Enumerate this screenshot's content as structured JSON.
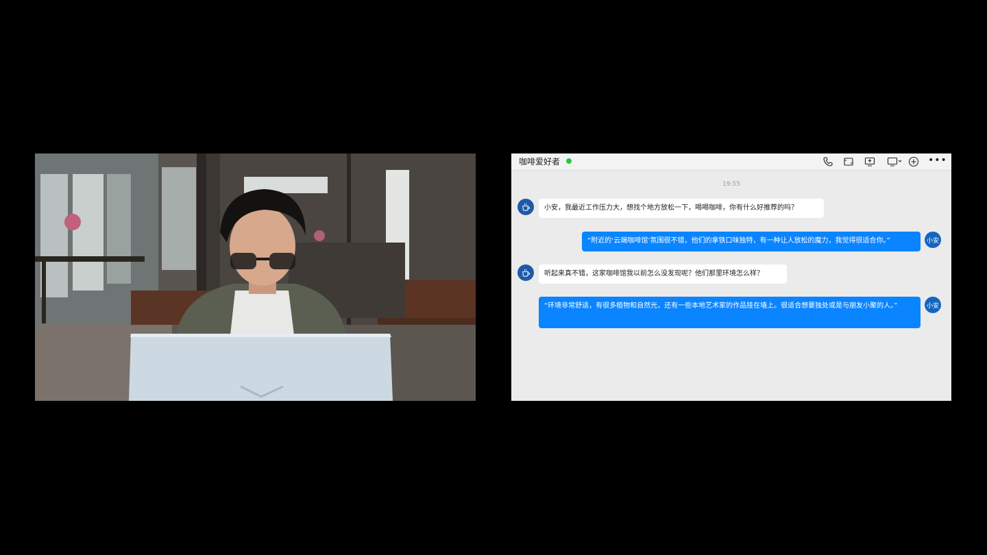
{
  "chat": {
    "title": "咖啡爱好者",
    "status_color": "#28c840",
    "timestamp": "19:55",
    "messages": [
      {
        "sender": "contact",
        "avatar_icon": "coffee-cup-icon",
        "text": "小安，我最近工作压力大，想找个地方放松一下，喝喝咖啡，你有什么好推荐的吗？"
      },
      {
        "sender": "me",
        "avatar_label": "小安",
        "text": "“附近的‘云端咖啡馆’氛围很不错，他们的拿铁口味独特，有一种让人放松的魔力，我觉得很适合你。”"
      },
      {
        "sender": "contact",
        "avatar_icon": "coffee-cup-icon",
        "text": "听起来真不错，这家咖啡馆我以前怎么没发现呢？他们那里环境怎么样？"
      },
      {
        "sender": "me",
        "avatar_label": "小安",
        "text": "“环境非常舒适，有很多植物和自然光，还有一些本地艺术家的作品挂在墙上。很适合想要独处或是与朋友小聚的人。”"
      }
    ]
  },
  "header_icons": [
    "phone-icon",
    "video-call-icon",
    "screen-share-icon",
    "remote-desktop-icon",
    "add-icon",
    "more-icon"
  ],
  "colors": {
    "accent": "#0a84ff",
    "avatar": "#1565c0",
    "chat_bg": "#ebebeb"
  }
}
